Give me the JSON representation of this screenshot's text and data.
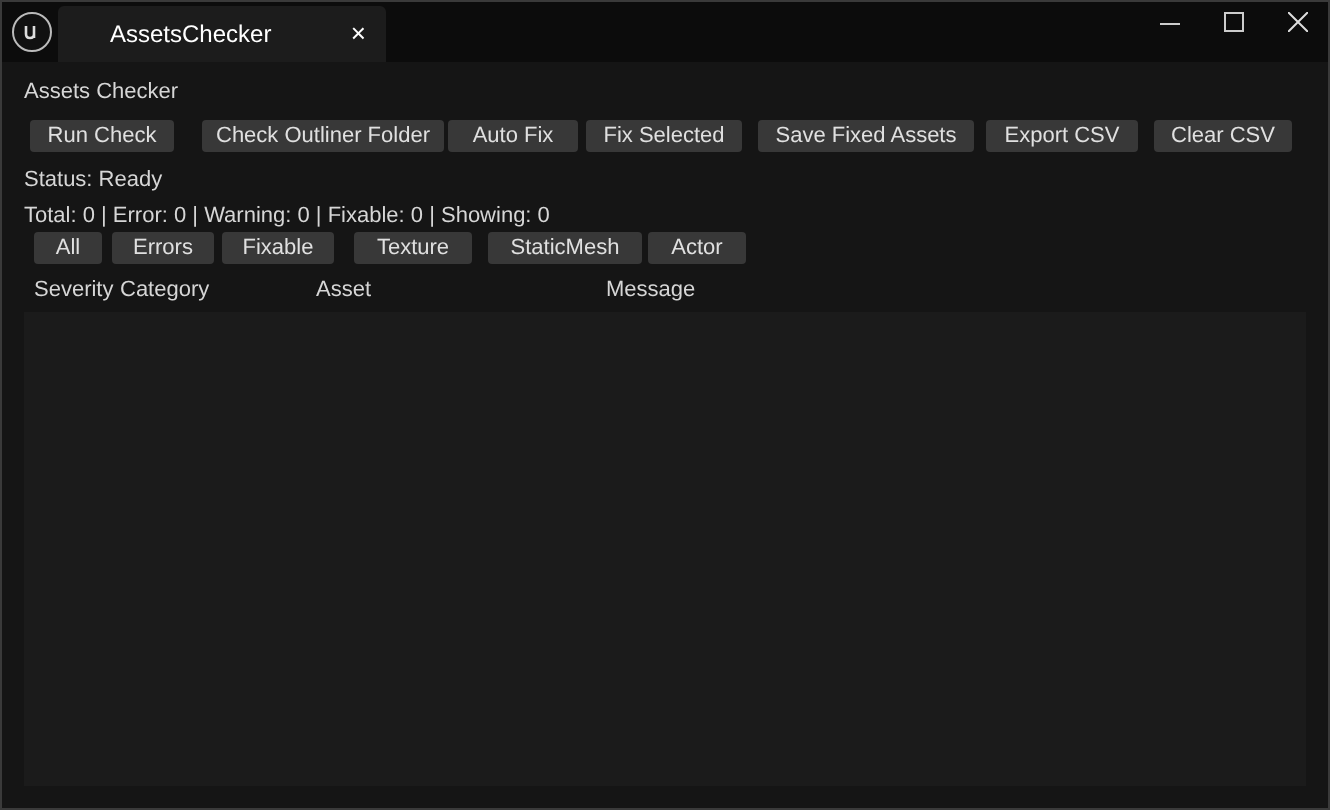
{
  "window": {
    "tab": "AssetsChecker",
    "tab_close": "×"
  },
  "panel_title": "Assets Checker",
  "actions": [
    "Run Check",
    "Check Outliner Folder",
    "Auto Fix",
    "Fix Selected",
    "Save Fixed Assets",
    "Export CSV",
    "Clear CSV"
  ],
  "status": "Status: Ready",
  "summary": "Total: 0 | Error: 0 | Warning: 0 | Fixable: 0 | Showing: 0",
  "filters": [
    "All",
    "Errors",
    "Fixable",
    "Texture",
    "StaticMesh",
    "Actor"
  ],
  "table": {
    "columns": [
      "Severity",
      "Category",
      "Asset",
      "Message"
    ]
  }
}
